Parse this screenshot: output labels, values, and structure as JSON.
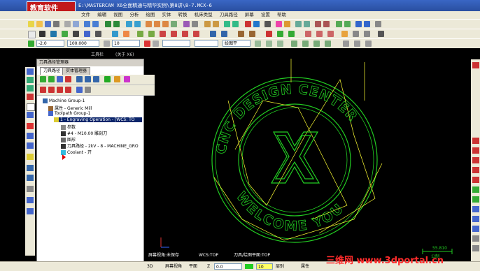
{
  "window": {
    "logo_text": "教育软件",
    "title": "E:\\MASTERCAM X6全面精通与精华实例\\第8讲\\8-7.MCX-6"
  },
  "menu": [
    "文件",
    "编辑",
    "视图",
    "分析",
    "绘图",
    "实体",
    "转换",
    "机床类型",
    "刀具路径",
    "屏幕",
    "设置",
    "帮助"
  ],
  "toolbar3": {
    "z_value": "-2.0",
    "level_value": "100.000",
    "level_label": "层别",
    "attr_value": "10",
    "view_value": "绘图平",
    "tool_label": "工具栏",
    "close_label": "(关于 X6)"
  },
  "ops_manager": {
    "title": "刀具路径管理器",
    "tabs": [
      "刀具路径",
      "实体管理器"
    ],
    "tree": [
      "Machine Group-1",
      "属性 - Generic Mill",
      "Toolpath Group-1",
      "1 - Engraving Operation - [WCS: TO",
      "参数",
      "#4 - M10.00 雕刻刀",
      "图形",
      "刀具路径 - 2kV - 8 - MACHINE_GRO",
      "Coolant - 开"
    ]
  },
  "canvas": {
    "graphic_text_top": "CNC DESIGN CENTER",
    "graphic_text_bottom": "WELCOME YOU",
    "scale_value": "55.810",
    "scale_unit": "公制",
    "view_info": "屏幕视角:未保存",
    "wcs_info": "WCS:TOP",
    "tplane_info": "刀具/绘图平面:TOP",
    "colors": {
      "green": "#22cc22",
      "yellow": "#ffff33",
      "bg": "#000000"
    }
  },
  "statusbar": {
    "items": [
      "3D",
      "屏幕视角",
      "平面",
      "Z",
      "0.0",
      "10",
      "层别",
      "属性"
    ]
  },
  "watermark": "三维网 www.3dportal.cn"
}
